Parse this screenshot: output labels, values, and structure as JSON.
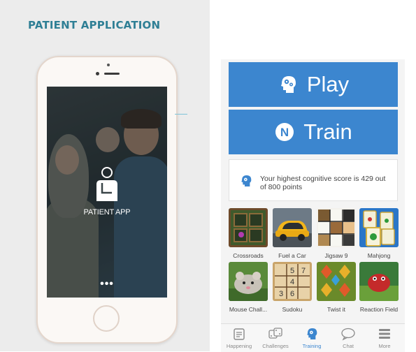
{
  "left": {
    "title": "PATIENT APPLICATION",
    "app_label": "PATIENT APP",
    "dots": "•••"
  },
  "right": {
    "play_label": "Play",
    "train_label": "Train",
    "train_badge": "N",
    "score_text": "Your highest cognitive score is 429 out of 800 points",
    "games": [
      {
        "label": "Crossroads"
      },
      {
        "label": "Fuel a Car"
      },
      {
        "label": "Jigsaw 9"
      },
      {
        "label": "Mahjong"
      },
      {
        "label": "Mouse Chall..."
      },
      {
        "label": "Sudoku"
      },
      {
        "label": "Twist it"
      },
      {
        "label": "Reaction Field"
      }
    ],
    "sudoku_digits": [
      "5",
      "7",
      "4",
      "3",
      "6"
    ],
    "tabs": [
      {
        "label": "Happening",
        "icon": "happening-icon"
      },
      {
        "label": "Challenges",
        "icon": "dice-icon"
      },
      {
        "label": "Training",
        "icon": "head-gear-icon",
        "active": true
      },
      {
        "label": "Chat",
        "icon": "chat-bubble-icon"
      },
      {
        "label": "More",
        "icon": "menu-icon"
      }
    ]
  },
  "colors": {
    "accent_blue": "#3c86cf",
    "title_teal": "#2f7f95",
    "left_background": "#ececec"
  }
}
